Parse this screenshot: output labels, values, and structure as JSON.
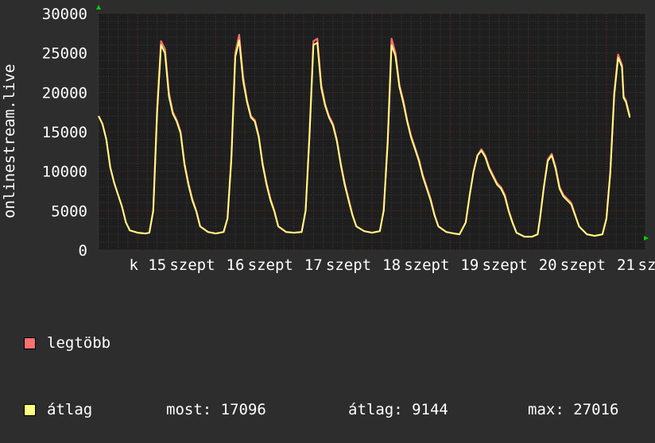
{
  "chart_data": {
    "type": "line",
    "ylabel": "onlinestream.live",
    "ylim": [
      0,
      30000
    ],
    "y_ticks": [
      0,
      5000,
      10000,
      15000,
      20000,
      25000,
      30000
    ],
    "x_tick_labels": [
      {
        "t": 0.45,
        "label": "k"
      },
      {
        "t": 0.75,
        "label": "15"
      },
      {
        "t": 1.2,
        "label": "szept"
      },
      {
        "t": 1.75,
        "label": "16"
      },
      {
        "t": 2.2,
        "label": "szept"
      },
      {
        "t": 2.75,
        "label": "17"
      },
      {
        "t": 3.2,
        "label": "szept"
      },
      {
        "t": 3.75,
        "label": "18"
      },
      {
        "t": 4.2,
        "label": "szept"
      },
      {
        "t": 4.75,
        "label": "19"
      },
      {
        "t": 5.2,
        "label": "szept"
      },
      {
        "t": 5.75,
        "label": "20"
      },
      {
        "t": 6.2,
        "label": "szept"
      },
      {
        "t": 6.75,
        "label": "21"
      },
      {
        "t": 7.02,
        "label": "sz"
      }
    ],
    "xlim": [
      0,
      7
    ],
    "series": [
      {
        "name": "legtöbb",
        "color": "#ff7070",
        "points": [
          [
            0.0,
            17000
          ],
          [
            0.05,
            16000
          ],
          [
            0.1,
            14000
          ],
          [
            0.15,
            10500
          ],
          [
            0.2,
            8500
          ],
          [
            0.25,
            7000
          ],
          [
            0.3,
            5500
          ],
          [
            0.35,
            3500
          ],
          [
            0.4,
            2500
          ],
          [
            0.5,
            2200
          ],
          [
            0.6,
            2100
          ],
          [
            0.65,
            2200
          ],
          [
            0.7,
            5000
          ],
          [
            0.75,
            18000
          ],
          [
            0.8,
            26500
          ],
          [
            0.85,
            25500
          ],
          [
            0.9,
            20000
          ],
          [
            0.95,
            17500
          ],
          [
            1.0,
            16500
          ],
          [
            1.05,
            15000
          ],
          [
            1.1,
            11000
          ],
          [
            1.15,
            8500
          ],
          [
            1.2,
            6500
          ],
          [
            1.25,
            5000
          ],
          [
            1.3,
            3000
          ],
          [
            1.4,
            2300
          ],
          [
            1.5,
            2100
          ],
          [
            1.6,
            2300
          ],
          [
            1.65,
            4000
          ],
          [
            1.7,
            12000
          ],
          [
            1.75,
            25000
          ],
          [
            1.8,
            27300
          ],
          [
            1.85,
            22000
          ],
          [
            1.9,
            19000
          ],
          [
            1.95,
            17000
          ],
          [
            2.0,
            16500
          ],
          [
            2.05,
            14500
          ],
          [
            2.1,
            11000
          ],
          [
            2.15,
            8500
          ],
          [
            2.2,
            6500
          ],
          [
            2.25,
            5000
          ],
          [
            2.3,
            3000
          ],
          [
            2.4,
            2300
          ],
          [
            2.5,
            2200
          ],
          [
            2.6,
            2300
          ],
          [
            2.65,
            5000
          ],
          [
            2.7,
            15000
          ],
          [
            2.75,
            26500
          ],
          [
            2.8,
            26800
          ],
          [
            2.85,
            21000
          ],
          [
            2.9,
            18500
          ],
          [
            2.95,
            17000
          ],
          [
            3.0,
            16000
          ],
          [
            3.05,
            14000
          ],
          [
            3.1,
            11000
          ],
          [
            3.15,
            8500
          ],
          [
            3.2,
            6500
          ],
          [
            3.25,
            4500
          ],
          [
            3.3,
            3000
          ],
          [
            3.4,
            2400
          ],
          [
            3.5,
            2200
          ],
          [
            3.6,
            2400
          ],
          [
            3.65,
            5000
          ],
          [
            3.7,
            14000
          ],
          [
            3.75,
            26800
          ],
          [
            3.8,
            25000
          ],
          [
            3.85,
            21000
          ],
          [
            3.9,
            19000
          ],
          [
            3.95,
            16500
          ],
          [
            4.0,
            14500
          ],
          [
            4.05,
            13000
          ],
          [
            4.1,
            11500
          ],
          [
            4.15,
            9500
          ],
          [
            4.2,
            8000
          ],
          [
            4.25,
            6500
          ],
          [
            4.3,
            4500
          ],
          [
            4.35,
            3000
          ],
          [
            4.45,
            2300
          ],
          [
            4.55,
            2100
          ],
          [
            4.62,
            2000
          ],
          [
            4.7,
            3500
          ],
          [
            4.75,
            7000
          ],
          [
            4.8,
            10000
          ],
          [
            4.85,
            12000
          ],
          [
            4.9,
            12800
          ],
          [
            4.95,
            12000
          ],
          [
            5.0,
            10500
          ],
          [
            5.05,
            9500
          ],
          [
            5.1,
            8500
          ],
          [
            5.15,
            8000
          ],
          [
            5.2,
            7000
          ],
          [
            5.25,
            5000
          ],
          [
            5.3,
            3500
          ],
          [
            5.35,
            2200
          ],
          [
            5.45,
            1700
          ],
          [
            5.55,
            1700
          ],
          [
            5.62,
            2000
          ],
          [
            5.65,
            4000
          ],
          [
            5.7,
            8000
          ],
          [
            5.75,
            11500
          ],
          [
            5.8,
            12200
          ],
          [
            5.85,
            10500
          ],
          [
            5.9,
            8000
          ],
          [
            5.95,
            7000
          ],
          [
            6.0,
            6500
          ],
          [
            6.05,
            6000
          ],
          [
            6.1,
            4500
          ],
          [
            6.15,
            3000
          ],
          [
            6.25,
            2000
          ],
          [
            6.35,
            1800
          ],
          [
            6.45,
            2000
          ],
          [
            6.5,
            4000
          ],
          [
            6.55,
            10000
          ],
          [
            6.6,
            20000
          ],
          [
            6.65,
            24800
          ],
          [
            6.7,
            23500
          ],
          [
            6.72,
            19500
          ],
          [
            6.75,
            19000
          ],
          [
            6.8,
            17000
          ]
        ]
      },
      {
        "name": "átlag",
        "color": "#ffff80",
        "points": [
          [
            0.0,
            17000
          ],
          [
            0.05,
            16000
          ],
          [
            0.1,
            14000
          ],
          [
            0.15,
            10500
          ],
          [
            0.2,
            8500
          ],
          [
            0.25,
            7000
          ],
          [
            0.3,
            5500
          ],
          [
            0.35,
            3500
          ],
          [
            0.4,
            2500
          ],
          [
            0.5,
            2200
          ],
          [
            0.6,
            2100
          ],
          [
            0.65,
            2200
          ],
          [
            0.7,
            5000
          ],
          [
            0.75,
            17500
          ],
          [
            0.8,
            26000
          ],
          [
            0.85,
            25000
          ],
          [
            0.9,
            19500
          ],
          [
            0.95,
            17300
          ],
          [
            1.0,
            16300
          ],
          [
            1.05,
            14800
          ],
          [
            1.1,
            10800
          ],
          [
            1.15,
            8300
          ],
          [
            1.2,
            6300
          ],
          [
            1.25,
            4900
          ],
          [
            1.3,
            3000
          ],
          [
            1.4,
            2300
          ],
          [
            1.5,
            2100
          ],
          [
            1.6,
            2300
          ],
          [
            1.65,
            4000
          ],
          [
            1.7,
            11500
          ],
          [
            1.75,
            24500
          ],
          [
            1.8,
            26600
          ],
          [
            1.85,
            21500
          ],
          [
            1.9,
            18800
          ],
          [
            1.95,
            16800
          ],
          [
            2.0,
            16300
          ],
          [
            2.05,
            14300
          ],
          [
            2.1,
            10800
          ],
          [
            2.15,
            8300
          ],
          [
            2.2,
            6300
          ],
          [
            2.25,
            4900
          ],
          [
            2.3,
            3000
          ],
          [
            2.4,
            2300
          ],
          [
            2.5,
            2200
          ],
          [
            2.6,
            2300
          ],
          [
            2.65,
            5000
          ],
          [
            2.7,
            14500
          ],
          [
            2.75,
            26000
          ],
          [
            2.8,
            26300
          ],
          [
            2.85,
            20600
          ],
          [
            2.9,
            18300
          ],
          [
            2.95,
            16800
          ],
          [
            3.0,
            15800
          ],
          [
            3.05,
            13800
          ],
          [
            3.1,
            10800
          ],
          [
            3.15,
            8300
          ],
          [
            3.2,
            6300
          ],
          [
            3.25,
            4400
          ],
          [
            3.3,
            3000
          ],
          [
            3.4,
            2400
          ],
          [
            3.5,
            2200
          ],
          [
            3.6,
            2400
          ],
          [
            3.65,
            5000
          ],
          [
            3.7,
            13500
          ],
          [
            3.75,
            26000
          ],
          [
            3.8,
            24600
          ],
          [
            3.85,
            20700
          ],
          [
            3.9,
            18700
          ],
          [
            3.95,
            16300
          ],
          [
            4.0,
            14300
          ],
          [
            4.05,
            12800
          ],
          [
            4.1,
            11300
          ],
          [
            4.15,
            9300
          ],
          [
            4.2,
            7800
          ],
          [
            4.25,
            6300
          ],
          [
            4.3,
            4400
          ],
          [
            4.35,
            3000
          ],
          [
            4.45,
            2300
          ],
          [
            4.55,
            2100
          ],
          [
            4.62,
            2000
          ],
          [
            4.7,
            3500
          ],
          [
            4.75,
            7000
          ],
          [
            4.8,
            10000
          ],
          [
            4.85,
            12000
          ],
          [
            4.9,
            12600
          ],
          [
            4.95,
            11800
          ],
          [
            5.0,
            10300
          ],
          [
            5.05,
            9300
          ],
          [
            5.1,
            8300
          ],
          [
            5.15,
            7800
          ],
          [
            5.2,
            6800
          ],
          [
            5.25,
            4900
          ],
          [
            5.3,
            3400
          ],
          [
            5.35,
            2200
          ],
          [
            5.45,
            1700
          ],
          [
            5.55,
            1700
          ],
          [
            5.62,
            2000
          ],
          [
            5.65,
            4000
          ],
          [
            5.7,
            8000
          ],
          [
            5.75,
            11300
          ],
          [
            5.8,
            12000
          ],
          [
            5.85,
            10300
          ],
          [
            5.9,
            7800
          ],
          [
            5.95,
            6800
          ],
          [
            6.0,
            6300
          ],
          [
            6.05,
            5800
          ],
          [
            6.1,
            4400
          ],
          [
            6.15,
            3000
          ],
          [
            6.25,
            2000
          ],
          [
            6.35,
            1800
          ],
          [
            6.45,
            2000
          ],
          [
            6.5,
            4000
          ],
          [
            6.55,
            9800
          ],
          [
            6.6,
            19600
          ],
          [
            6.65,
            24400
          ],
          [
            6.7,
            23200
          ],
          [
            6.72,
            19300
          ],
          [
            6.75,
            18800
          ],
          [
            6.8,
            16800
          ]
        ]
      }
    ],
    "legend": {
      "items": [
        {
          "label": "legtöbb",
          "color": "#ff7070"
        },
        {
          "label": "átlag",
          "color": "#ffff80"
        }
      ],
      "stats": {
        "now": "most: 17096",
        "avg": "átlag: 9144",
        "max": "max: 27016"
      }
    },
    "colors": {
      "background": "#2d2d2d",
      "plot": "#1e1e1e",
      "grid_minor": "#3a3a3a",
      "grid_major": "#6b2a2a",
      "axis_arrow": "#00d000"
    }
  }
}
